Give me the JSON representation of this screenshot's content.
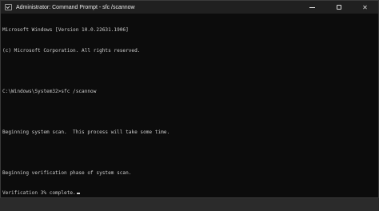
{
  "window": {
    "title": "Administrator: Command Prompt - sfc  /scannow",
    "icon": "terminal-icon",
    "controls": {
      "minimize": "minimize-icon",
      "maximize": "maximize-icon",
      "close": "✕"
    }
  },
  "console": {
    "lines": [
      "Microsoft Windows [Version 10.0.22631.1906]",
      "(c) Microsoft Corporation. All rights reserved.",
      "",
      "C:\\Windows\\System32>sfc /scannow",
      "",
      "Beginning system scan.  This process will take some time.",
      "",
      "Beginning verification phase of system scan.",
      "Verification 3% complete."
    ]
  },
  "colors": {
    "background": "#0c0c0c",
    "titlebar": "#202020",
    "text": "#cccccc"
  }
}
